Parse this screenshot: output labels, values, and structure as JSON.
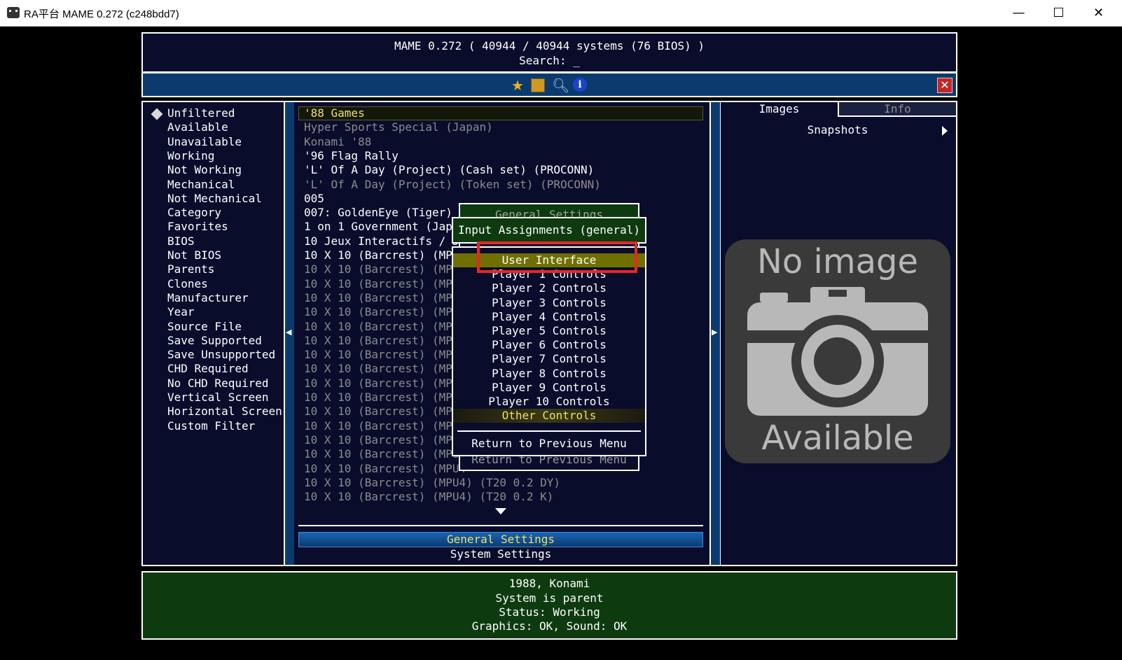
{
  "window": {
    "title": "RA平台 MAME 0.272 (c248bdd7)",
    "minimize": "—",
    "maximize": "☐",
    "close": "✕"
  },
  "header": {
    "line1": "MAME 0.272 ( 40944 / 40944 systems (76 BIOS) )",
    "line2": "Search: _"
  },
  "toolbar": {
    "icons": [
      "star-icon",
      "floppy-icon",
      "magnifier-icon",
      "info-icon",
      "close-icon"
    ],
    "info_glyph": "i",
    "close_glyph": "✕"
  },
  "filters": [
    "Unfiltered",
    "Available",
    "Unavailable",
    "Working",
    "Not Working",
    "Mechanical",
    "Not Mechanical",
    "Category",
    "Favorites",
    "BIOS",
    "Not BIOS",
    "Parents",
    "Clones",
    "Manufacturer",
    "Year",
    "Source File",
    "Save Supported",
    "Save Unsupported",
    "CHD Required",
    "No CHD Required",
    "Vertical Screen",
    "Horizontal Screen",
    "Custom Filter"
  ],
  "games": [
    {
      "name": "'88 Games",
      "style": "sel"
    },
    {
      "name": "Hyper Sports Special (Japan)",
      "style": "dim"
    },
    {
      "name": "Konami '88",
      "style": "dim"
    },
    {
      "name": "'96 Flag Rally",
      "style": "normal"
    },
    {
      "name": "'L' Of A Day (Project) (Cash set) (PROCONN)",
      "style": "normal"
    },
    {
      "name": "'L' Of A Day (Project) (Token set) (PROCONN)",
      "style": "dim"
    },
    {
      "name": "005",
      "style": "normal"
    },
    {
      "name": "007: GoldenEye (Tiger)",
      "style": "normal"
    },
    {
      "name": "1 on 1 Government (Japa",
      "style": "normal"
    },
    {
      "name": "10 Jeux Interactifs / Jeu",
      "style": "normal"
    },
    {
      "name": "10 X 10 (Barcrest) (MPU",
      "style": "normal"
    },
    {
      "name": "10 X 10 (Barcrest) (MPU",
      "style": "dim"
    },
    {
      "name": "10 X 10 (Barcrest) (MPU",
      "style": "dim"
    },
    {
      "name": "10 X 10 (Barcrest) (MPU",
      "style": "dim"
    },
    {
      "name": "10 X 10 (Barcrest) (MPU",
      "style": "dim"
    },
    {
      "name": "10 X 10 (Barcrest) (MPU",
      "style": "dim"
    },
    {
      "name": "10 X 10 (Barcrest) (MPU",
      "style": "dim"
    },
    {
      "name": "10 X 10 (Barcrest) (MPU",
      "style": "dim"
    },
    {
      "name": "10 X 10 (Barcrest) (MPU",
      "style": "dim"
    },
    {
      "name": "10 X 10 (Barcrest) (MPU",
      "style": "dim"
    },
    {
      "name": "10 X 10 (Barcrest) (MPU",
      "style": "dim"
    },
    {
      "name": "10 X 10 (Barcrest) (MPU",
      "style": "dim"
    },
    {
      "name": "10 X 10 (Barcrest) (MPU",
      "style": "dim"
    },
    {
      "name": "10 X 10 (Barcrest) (MPU",
      "style": "dim"
    },
    {
      "name": "10 X 10 (Barcrest) (MPU",
      "style": "dim"
    },
    {
      "name": "10 X 10 (Barcrest) (MPU4",
      "style": "dim"
    },
    {
      "name": "10 X 10 (Barcrest) (MPU4) (T20 0.2 DY)",
      "style": "dim"
    },
    {
      "name": "10 X 10 (Barcrest) (MPU4) (T20 0.2 K)",
      "style": "dim"
    }
  ],
  "list_footer": {
    "general_settings": "General Settings",
    "system_settings": "System Settings"
  },
  "right_panel": {
    "tab_images": "Images",
    "tab_info": "Info",
    "snapshots": "Snapshots",
    "no_image_line1": "No image",
    "no_image_line2": "Available"
  },
  "footer": {
    "line1": "1988, Konami",
    "line2": "System is parent",
    "line3": "Status: Working",
    "line4": "Graphics: OK, Sound: OK"
  },
  "general_settings_menu": {
    "title": "General Settings",
    "return_label": "Return to Previous Menu"
  },
  "input_menu": {
    "title": "Input Assignments (general)",
    "items": [
      "User Interface",
      "Player 1 Controls",
      "Player 2 Controls",
      "Player 3 Controls",
      "Player 4 Controls",
      "Player 5 Controls",
      "Player 6 Controls",
      "Player 7 Controls",
      "Player 8 Controls",
      "Player 9 Controls",
      "Player 10 Controls",
      "Other Controls"
    ],
    "return_label": "Return to Previous Menu"
  },
  "colors": {
    "panel_bg": "#0a0c2c",
    "highlight_bg": "#707000",
    "selected_text": "#f0e060",
    "title_green": "#0e3a10",
    "annotation_red": "#e52828"
  }
}
